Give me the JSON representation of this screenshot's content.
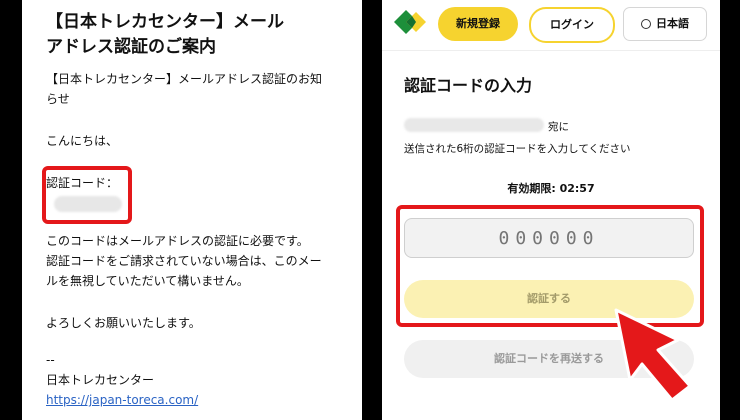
{
  "email": {
    "title_line1": "【日本トレカセンター】メール",
    "title_line2": "アドレス認証のご案内",
    "body_line1": "【日本トレカセンター】メールアドレス認証のお知",
    "body_line2": "らせ",
    "greeting": "こんにちは、",
    "code_label": "認証コード：",
    "notice_line1": "このコードはメールアドレスの認証に必要です。",
    "notice_line2": "認証コードをご請求されていない場合は、このメー",
    "notice_line3": "ルを無視していただいて構いません。",
    "closing": "よろしくお願いいたします。",
    "separator": "--",
    "signature": "日本トレカセンター",
    "link": "https://japan-toreca.com/"
  },
  "header": {
    "register_label": "新規登録",
    "login_label": "ログイン",
    "language_label": "日本語"
  },
  "verify": {
    "title": "認証コードの入力",
    "recipient_suffix": "宛に",
    "instruction": "送信された6桁の認証コードを入力してください",
    "expiry": "有効期限: 02:57",
    "code_placeholder": "000000",
    "submit_label": "認証する",
    "resend_label": "認証コードを再送する"
  },
  "colors": {
    "highlight": "#e4181a",
    "brand_yellow": "#f6d32f",
    "logo_green": "#1d8f3a"
  }
}
